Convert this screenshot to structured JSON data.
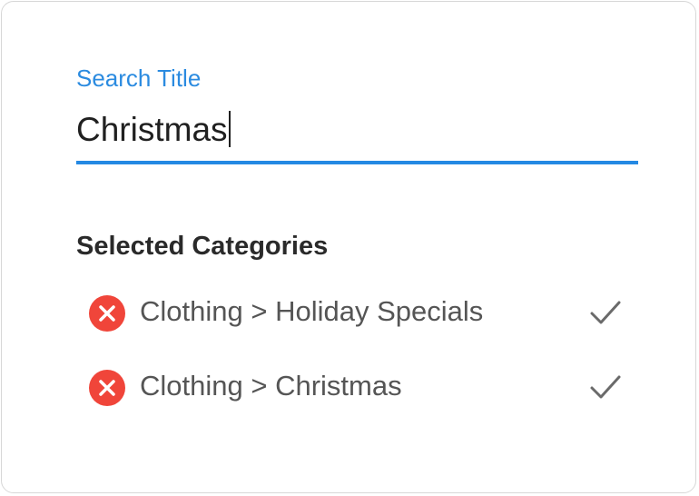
{
  "search": {
    "label": "Search Title",
    "value": "Christmas"
  },
  "categories": {
    "title": "Selected Categories",
    "items": [
      {
        "label": "Clothing > Holiday Specials",
        "remove_icon": "remove-circle-icon",
        "status_icon": "checkmark-icon"
      },
      {
        "label": "Clothing > Christmas",
        "remove_icon": "remove-circle-icon",
        "status_icon": "checkmark-icon"
      }
    ]
  },
  "colors": {
    "accent": "#2489e3",
    "remove": "#f0453a",
    "text": "#202020",
    "muted": "#555555"
  }
}
